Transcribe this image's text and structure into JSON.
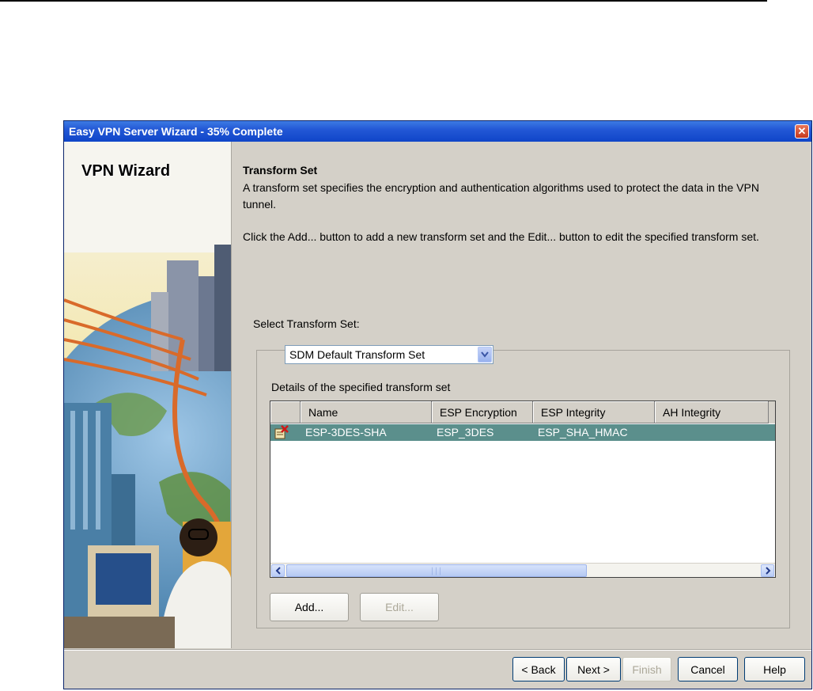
{
  "window": {
    "title": "Easy VPN Server Wizard - 35% Complete",
    "close_glyph": "✕"
  },
  "sidebar": {
    "title": "VPN Wizard"
  },
  "content": {
    "heading": "Transform Set",
    "description": "A transform set specifies the encryption and authentication algorithms used to protect the data in the VPN tunnel.",
    "instructions": "Click the Add... button to add a new transform set and the Edit... button to edit the specified transform set.",
    "select_label": "Select Transform Set:",
    "selected_transform_set": "SDM Default Transform Set",
    "details_label": "Details of the specified transform set"
  },
  "table": {
    "columns": [
      "",
      "Name",
      "ESP Encryption",
      "ESP Integrity",
      "AH Integrity"
    ],
    "rows": [
      {
        "name": "ESP-3DES-SHA",
        "esp_encryption": "ESP_3DES",
        "esp_integrity": "ESP_SHA_HMAC",
        "ah_integrity": ""
      }
    ]
  },
  "buttons": {
    "add": "Add...",
    "edit": "Edit..."
  },
  "footer": {
    "back": "< Back",
    "next": "Next >",
    "finish": "Finish",
    "cancel": "Cancel",
    "help": "Help"
  },
  "colors": {
    "titlebar": "#0f45c8",
    "selected_row": "#5b8f8c",
    "dialog_bg": "#d4d0c8"
  }
}
